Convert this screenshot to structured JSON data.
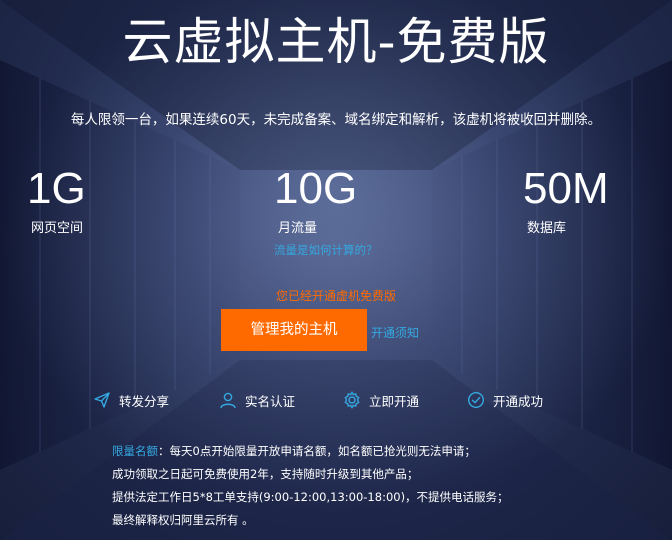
{
  "header": {
    "title": "云虚拟主机-免费版",
    "subtitle": "每人限领一台，如果连续60天，未完成备案、域名绑定和解析，该虚机将被收回并删除。"
  },
  "stats": [
    {
      "value": "1G",
      "label": "网页空间"
    },
    {
      "value": "10G",
      "label": "月流量",
      "link": "流量是如何计算的？"
    },
    {
      "value": "50M",
      "label": "数据库"
    }
  ],
  "action": {
    "notice": "您已经开通虚机免费版",
    "button": "管理我的主机",
    "help_link": "开通须知"
  },
  "steps": [
    {
      "label": "转发分享",
      "icon": "send-icon"
    },
    {
      "label": "实名认证",
      "icon": "user-icon"
    },
    {
      "label": "立即开通",
      "icon": "gear-icon"
    },
    {
      "label": "开通成功",
      "icon": "check-circle-icon"
    }
  ],
  "rules": {
    "highlight": "限量名额",
    "line1": "：每天0点开始限量开放申请名额，如名额已抢光则无法申请；",
    "line2": "成功领取之日起可免费使用2年，支持随时升级到其他产品；",
    "line3": "提供法定工作日5*8工单支持(9:00-12:00,13:00-18:00)，不提供电话服务；",
    "line4": "最终解释权归阿里云所有 。"
  },
  "colors": {
    "accent": "#ff6a00",
    "link": "#34a8e0",
    "background": "#2e3a63"
  }
}
